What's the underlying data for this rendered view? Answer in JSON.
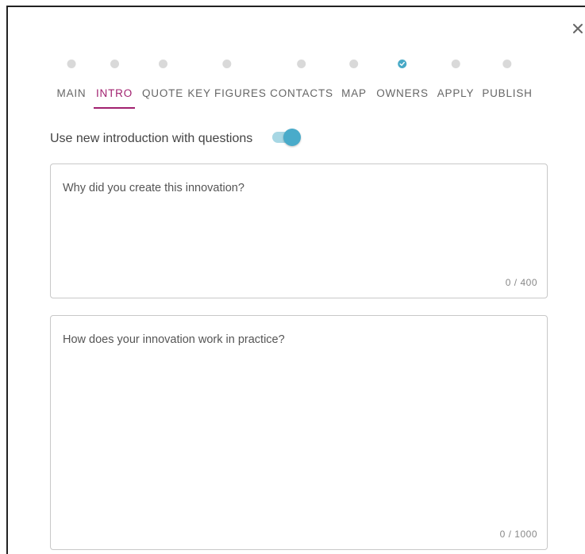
{
  "dialog": {
    "close_icon": "close-icon",
    "steps": [
      {
        "label": "MAIN",
        "status": "pending"
      },
      {
        "label": "INTRO",
        "status": "active"
      },
      {
        "label": "QUOTE",
        "status": "pending"
      },
      {
        "label": "KEY FIGURES",
        "status": "pending"
      },
      {
        "label": "CONTACTS",
        "status": "pending"
      },
      {
        "label": "MAP",
        "status": "pending"
      },
      {
        "label": "OWNERS",
        "status": "done"
      },
      {
        "label": "APPLY",
        "status": "pending"
      },
      {
        "label": "PUBLISH",
        "status": "pending"
      }
    ],
    "toggle": {
      "label": "Use new introduction with questions",
      "checked": true
    },
    "fields": [
      {
        "placeholder": "Why did you create this innovation?",
        "value": "",
        "counter": "0 / 400"
      },
      {
        "placeholder": "How does your innovation work in practice?",
        "value": "",
        "counter": "0 / 1000"
      }
    ]
  },
  "colors": {
    "accent_active": "#a1216f",
    "toggle_on": "#49abca",
    "toggle_track": "#a7d7e4",
    "step_done": "#47a9c6",
    "step_pending": "#d9d9d9"
  }
}
